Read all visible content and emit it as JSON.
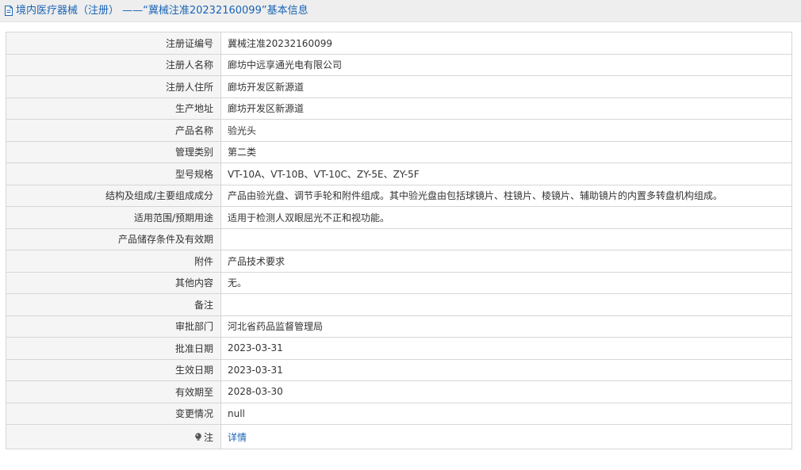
{
  "header": {
    "icon": "document-icon",
    "title": "境内医疗器械（注册） ——“冀械注准20232160099”基本信息"
  },
  "rows": [
    {
      "label": "注册证编号",
      "value": "冀械注准20232160099"
    },
    {
      "label": "注册人名称",
      "value": "廊坊中远享通光电有限公司"
    },
    {
      "label": "注册人住所",
      "value": "廊坊开发区新源道"
    },
    {
      "label": "生产地址",
      "value": "廊坊开发区新源道"
    },
    {
      "label": "产品名称",
      "value": "验光头"
    },
    {
      "label": "管理类别",
      "value": "第二类"
    },
    {
      "label": "型号规格",
      "value": "VT-10A、VT-10B、VT-10C、ZY-5E、ZY-5F"
    },
    {
      "label": "结构及组成/主要组成成分",
      "value": "产品由验光盘、调节手轮和附件组成。其中验光盘由包括球镜片、柱镜片、棱镜片、辅助镜片的内置多转盘机构组成。"
    },
    {
      "label": "适用范围/预期用途",
      "value": "适用于检测人双眼屈光不正和视功能。"
    },
    {
      "label": "产品储存条件及有效期",
      "value": ""
    },
    {
      "label": "附件",
      "value": "产品技术要求"
    },
    {
      "label": "其他内容",
      "value": "无。"
    },
    {
      "label": "备注",
      "value": ""
    },
    {
      "label": "审批部门",
      "value": "河北省药品监督管理局"
    },
    {
      "label": "批准日期",
      "value": "2023-03-31"
    },
    {
      "label": "生效日期",
      "value": "2023-03-31"
    },
    {
      "label": "有效期至",
      "value": "2028-03-30"
    },
    {
      "label": "变更情况",
      "value": "null"
    }
  ],
  "note_row": {
    "icon": "lightbulb-icon",
    "label": "注",
    "link_text": "详情"
  },
  "colors": {
    "accent": "#1a64b5",
    "label_bg": "#f5f5f5",
    "border": "#d6d6d6",
    "header_bg": "#eeeeee"
  }
}
